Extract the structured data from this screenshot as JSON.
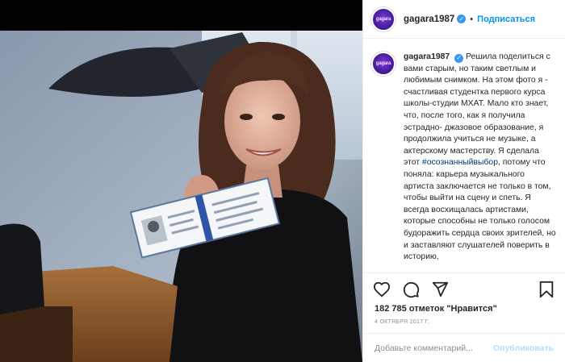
{
  "post": {
    "username": "gagara1987",
    "follow_label": "Подписаться",
    "separator": "•",
    "avatar_text": "gagara",
    "caption_text": "Решила поделиться с вами старым, но таким светлым и любимым снимком. На этом фото я - счастливая студентка первого курса школы-студии МХАТ. Мало кто знает, что, после того, как я получила эстрадно- джазовое образование, я продолжила учиться не музыке, а актерскому мастерству. Я сделала этот",
    "hashtag": "#осознанныйвыбор",
    "caption_text_2": ", потому что поняла: карьера музыкального артиста заключается не только в том, чтобы выйти на сцену и спеть. Я всегда восхищалась артистами, которые способны не только голосом будоражить сердца своих зрителей, но и заставляют слушателей поверить в историю,",
    "likes": "182 785 отметок \"Нравится\"",
    "date": "4 октября 2017 г.",
    "comment_placeholder": "Добавьте комментарий...",
    "post_label": "Опубликовать"
  },
  "icons": [
    "verified-badge-icon",
    "heart-icon",
    "comment-icon",
    "share-icon",
    "bookmark-icon"
  ],
  "colors": {
    "accent": "#0095f6",
    "verified": "#3897f0",
    "muted": "#8e8e8e",
    "post_disabled": "#b2dffc",
    "hashtag": "#00376b"
  }
}
